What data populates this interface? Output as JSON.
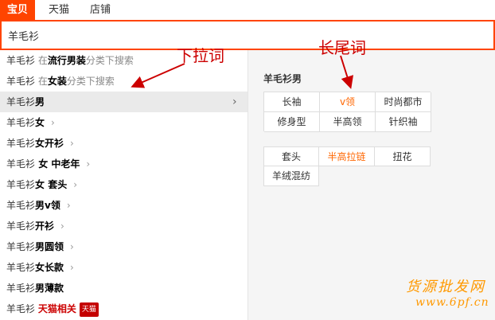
{
  "tabs": [
    {
      "label": "宝贝",
      "active": true
    },
    {
      "label": "天猫",
      "active": false
    },
    {
      "label": "店铺",
      "active": false
    }
  ],
  "search": {
    "value": "羊毛衫"
  },
  "suggestions": [
    {
      "kw": "羊毛衫",
      "in": "在",
      "cat": "流行男装",
      "tail": "分类下搜索"
    },
    {
      "kw": "羊毛衫",
      "in": "在",
      "cat": "女装",
      "tail": "分类下搜索"
    },
    {
      "prefix": "羊毛衫",
      "bold": "男"
    },
    {
      "prefix": "羊毛衫",
      "bold": "女"
    },
    {
      "prefix": "羊毛衫",
      "bold": "女开衫"
    },
    {
      "prefix": "羊毛衫",
      "bold": " 女 中老年"
    },
    {
      "prefix": "羊毛衫",
      "bold": "女 套头"
    },
    {
      "prefix": "羊毛衫",
      "bold": "男v领"
    },
    {
      "prefix": "羊毛衫",
      "bold": "开衫"
    },
    {
      "prefix": "羊毛衫",
      "bold": "男圆领"
    },
    {
      "prefix": "羊毛衫",
      "bold": "女长款"
    },
    {
      "prefix": "羊毛衫",
      "bold": "男薄款"
    },
    {
      "prefix": "羊毛衫 ",
      "hot": "天猫相关",
      "badge": "天猫"
    }
  ],
  "panel": {
    "title": "羊毛衫男",
    "group1": [
      "长袖",
      "v领",
      "时尚都市",
      "修身型",
      "半高领",
      "针织袖"
    ],
    "group2": [
      "套头",
      "半高拉链",
      "扭花",
      "羊绒混纺"
    ]
  },
  "annotations": {
    "dropdown_words": "下拉词",
    "long_tail_words": "长尾词"
  },
  "watermark": {
    "line1": "货源批发网",
    "line2": "www.6pf.cn"
  },
  "colors": {
    "accent": "#ff4400",
    "annotation": "#cc0000",
    "highlight": "#ff6600"
  }
}
